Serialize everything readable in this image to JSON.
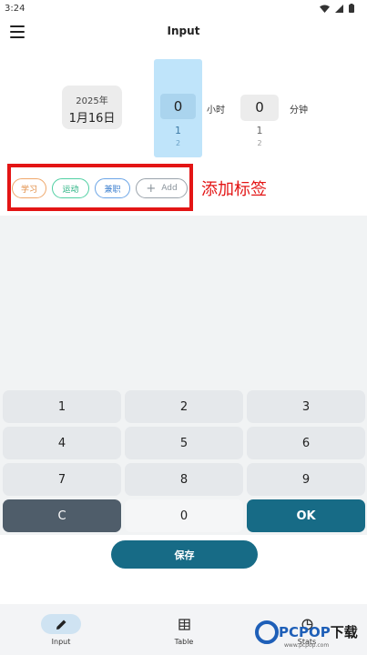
{
  "status_bar": {
    "time": "3:24"
  },
  "app_bar": {
    "title": "Input"
  },
  "date": {
    "year": "2025年",
    "day": "1月16日"
  },
  "time_picker": {
    "hour_value": "0",
    "hour_next": "1",
    "hour_next2": "2",
    "hour_unit": "小时",
    "minute_value": "0",
    "minute_next": "1",
    "minute_next2": "2",
    "minute_unit": "分钟"
  },
  "tags": [
    {
      "label": "学习",
      "color": "#e0893e"
    },
    {
      "label": "运动",
      "color": "#22b07e"
    },
    {
      "label": "兼职",
      "color": "#3c7fcf"
    }
  ],
  "add_tag": {
    "label": "Add"
  },
  "annotation": "添加标签",
  "keypad": {
    "keys": [
      "1",
      "2",
      "3",
      "4",
      "5",
      "6",
      "7",
      "8",
      "9",
      "C",
      "0",
      "OK"
    ]
  },
  "save_button": {
    "label": "保存"
  },
  "bottom_nav": {
    "items": [
      {
        "label": "Input",
        "icon": "pencil-icon",
        "active": true
      },
      {
        "label": "Table",
        "icon": "table-icon",
        "active": false
      },
      {
        "label": "Stats",
        "icon": "stats-icon",
        "active": false
      }
    ]
  },
  "watermark": {
    "brand": "PCPOP",
    "suffix": "下载",
    "sub": "www.pcpop.com"
  },
  "colors": {
    "accent": "#176b86",
    "clear_key": "#4f5d6a",
    "annotation": "#e31515",
    "hour_selected": "#bfe4fa"
  }
}
